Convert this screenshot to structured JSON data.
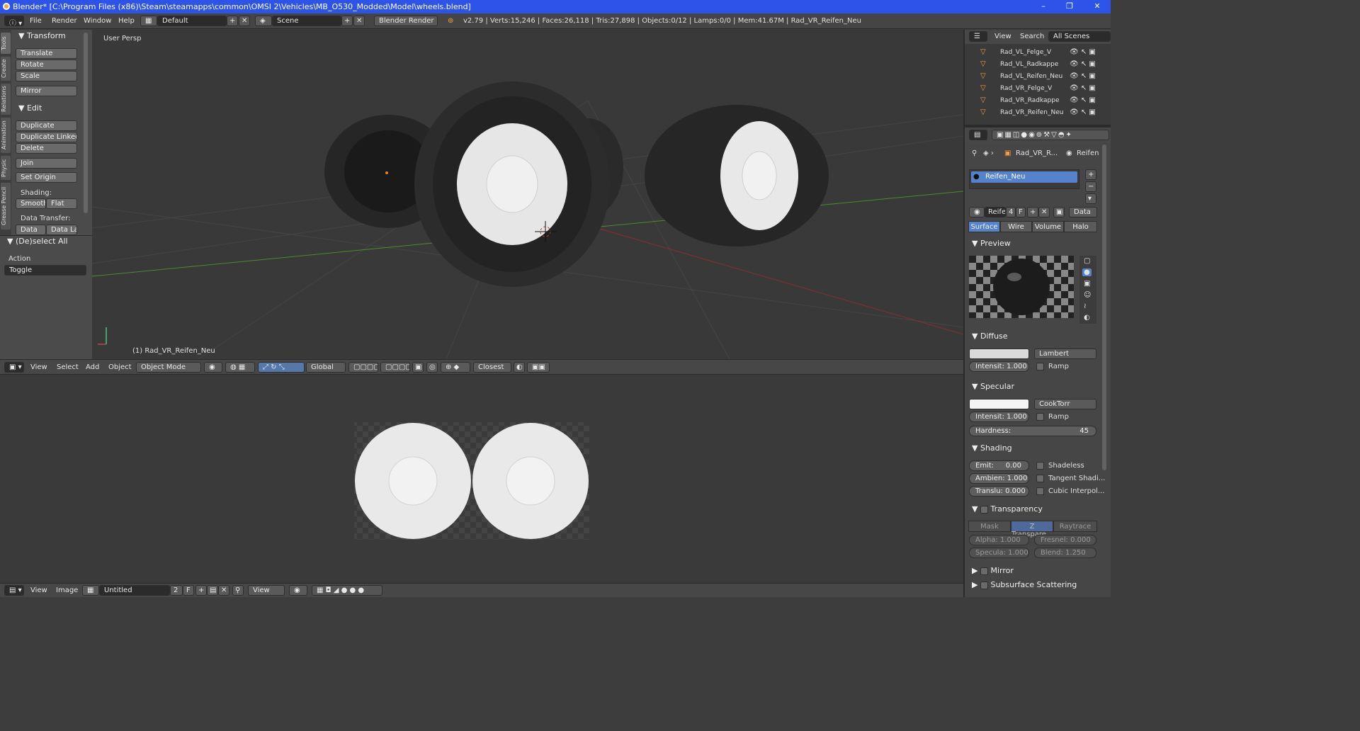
{
  "titlebar": {
    "title": "Blender* [C:\\Program Files (x86)\\Steam\\steamapps\\common\\OMSI 2\\Vehicles\\MB_O530_Modded\\Model\\wheels.blend]",
    "minimize": "–",
    "maximize": "❐",
    "close": "✕"
  },
  "infobar": {
    "menus": [
      "File",
      "Render",
      "Window",
      "Help"
    ],
    "layout": "Default",
    "scene": "Scene",
    "engine": "Blender Render",
    "stats": "v2.79 | Verts:15,246 | Faces:26,118 | Tris:27,898 | Objects:0/12 | Lamps:0/0 | Mem:41.67M | Rad_VR_Reifen_Neu"
  },
  "toolshelf": {
    "tabs": [
      "Tools",
      "Create",
      "Relations",
      "Animation",
      "Physic",
      "Grease Pencil"
    ],
    "transform_header": "Transform",
    "translate": "Translate",
    "rotate": "Rotate",
    "scale": "Scale",
    "mirror": "Mirror",
    "edit_header": "Edit",
    "duplicate": "Duplicate",
    "duplicate_linked": "Duplicate Linked",
    "delete": "Delete",
    "join": "Join",
    "set_origin": "Set Origin",
    "shading_label": "Shading:",
    "smooth": "Smooth",
    "flat": "Flat",
    "data_transfer_label": "Data Transfer:",
    "data": "Data",
    "data_la": "Data La",
    "deselect_header": "(De)select All",
    "action_label": "Action",
    "action_value": "Toggle"
  },
  "viewport": {
    "view_name": "User Persp",
    "object_label": "(1) Rad_VR_Reifen_Neu"
  },
  "viewport_header": {
    "menus": [
      "View",
      "Select",
      "Add",
      "Object"
    ],
    "mode": "Object Mode",
    "orientation": "Global",
    "snap": "Closest"
  },
  "image_header": {
    "menus": [
      "View",
      "Image"
    ],
    "image_name": "Untitled",
    "users": "2",
    "fake": "F",
    "view": "View"
  },
  "outliner": {
    "view": "View",
    "search": "Search",
    "scope": "All Scenes",
    "items": [
      "Rad_VL_Felge_V",
      "Rad_VL_Radkappe",
      "Rad_VL_Reifen_Neu",
      "Rad_VR_Felge_V",
      "Rad_VR_Radkappe",
      "Rad_VR_Reifen_Neu"
    ]
  },
  "properties": {
    "crumb_object": "Rad_VR_R...",
    "crumb_material": "Reifen",
    "material_slot": "Reifen_Neu",
    "material_name": "Reife",
    "material_users": "4",
    "material_fake": "F",
    "link": "Data",
    "tabs": [
      "Surface",
      "Wire",
      "Volume",
      "Halo"
    ],
    "preview_header": "Preview",
    "diffuse_header": "Diffuse",
    "diffuse_shader": "Lambert",
    "diffuse_intensity": "Intensit: 1.000",
    "ramp": "Ramp",
    "specular_header": "Specular",
    "specular_shader": "CookTorr",
    "specular_intensity": "Intensit: 1.000",
    "hardness_label": "Hardness:",
    "hardness_value": "45",
    "shading_header": "Shading",
    "emit": "Emit:",
    "emit_value": "0.00",
    "ambient": "Ambien: 1.000",
    "translucency": "Translu: 0.000",
    "shadeless": "Shadeless",
    "tangent": "Tangent Shadi...",
    "cubic": "Cubic Interpol...",
    "transparency_header": "Transparency",
    "mask": "Mask",
    "ztransp": "Z Transpare...",
    "raytrace": "Raytrace",
    "alpha": "Alpha: 1.000",
    "fresnel": "Fresnel: 0.000",
    "specula": "Specula: 1.000",
    "blend": "Blend: 1.250",
    "mirror_header": "Mirror",
    "sss_header": "Subsurface Scattering"
  }
}
